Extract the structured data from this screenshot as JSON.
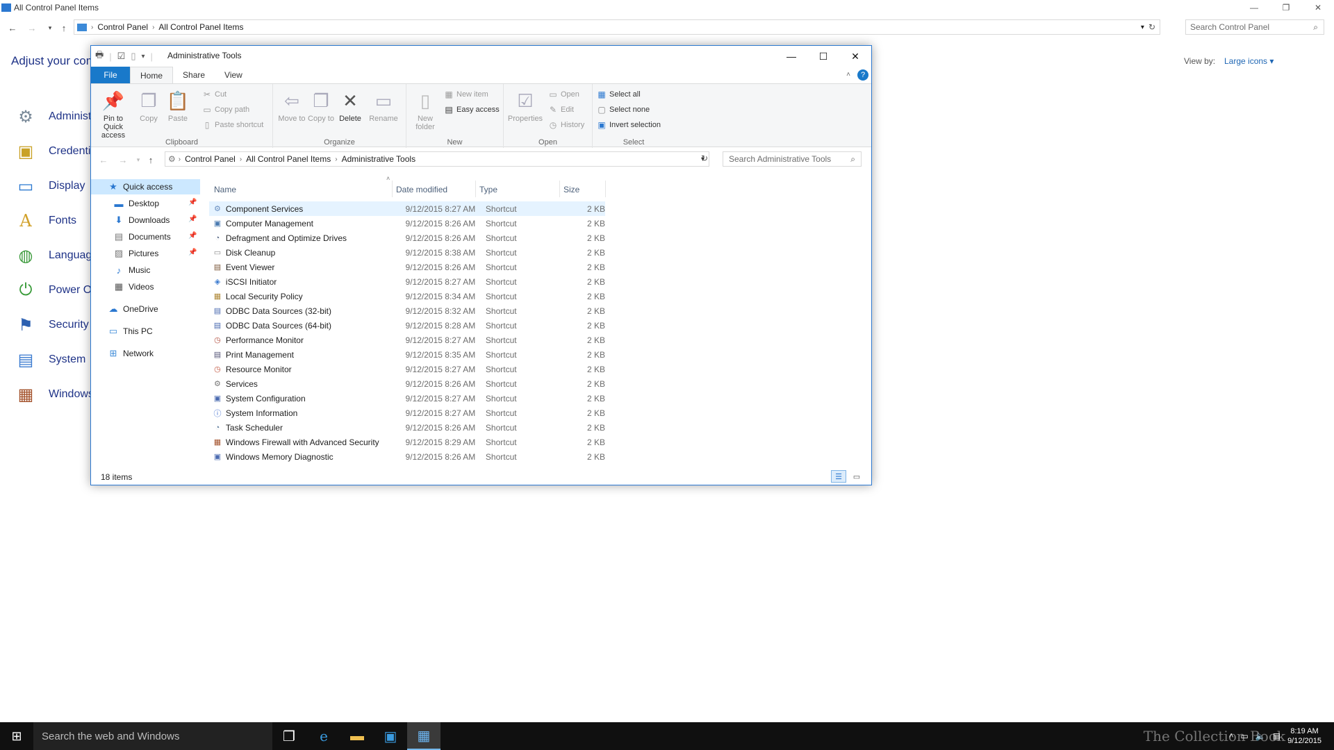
{
  "background": {
    "title": "All Control Panel Items",
    "breadcrumb": [
      "Control Panel",
      "All Control Panel Items"
    ],
    "search_placeholder": "Search Control Panel",
    "heading": "Adjust your com",
    "view_by_label": "View by:",
    "view_by_value": "Large icons ▾",
    "items": [
      {
        "label": "Administ",
        "icon": "admin-tools-icon"
      },
      {
        "label": "Credentia",
        "icon": "credential-icon"
      },
      {
        "label": "Display",
        "icon": "display-icon"
      },
      {
        "label": "Fonts",
        "icon": "fonts-icon"
      },
      {
        "label": "Language",
        "icon": "language-icon"
      },
      {
        "label": "Power Op",
        "icon": "power-icon"
      },
      {
        "label": "Security a",
        "icon": "security-flag-icon"
      },
      {
        "label": "System",
        "icon": "system-icon"
      },
      {
        "label": "Windows",
        "icon": "firewall-icon"
      }
    ]
  },
  "window": {
    "title": "Administrative Tools",
    "tabs": [
      "File",
      "Home",
      "Share",
      "View"
    ],
    "ribbon": {
      "clipboard": {
        "label": "Clipboard",
        "pin": "Pin to Quick access",
        "copy": "Copy",
        "paste": "Paste",
        "cut": "Cut",
        "copy_path": "Copy path",
        "paste_shortcut": "Paste shortcut"
      },
      "organize": {
        "label": "Organize",
        "move": "Move to",
        "copy": "Copy to",
        "delete": "Delete",
        "rename": "Rename"
      },
      "new": {
        "label": "New",
        "new_folder": "New folder",
        "new_item": "New item",
        "easy_access": "Easy access"
      },
      "open": {
        "label": "Open",
        "properties": "Properties",
        "open": "Open",
        "edit": "Edit",
        "history": "History"
      },
      "select": {
        "label": "Select",
        "all": "Select all",
        "none": "Select none",
        "invert": "Invert selection"
      }
    },
    "breadcrumb": [
      "Control Panel",
      "All Control Panel Items",
      "Administrative Tools"
    ],
    "search_placeholder": "Search Administrative Tools",
    "nav": {
      "quick_access": "Quick access",
      "desktop": "Desktop",
      "downloads": "Downloads",
      "documents": "Documents",
      "pictures": "Pictures",
      "music": "Music",
      "videos": "Videos",
      "onedrive": "OneDrive",
      "this_pc": "This PC",
      "network": "Network"
    },
    "columns": {
      "name": "Name",
      "date": "Date modified",
      "type": "Type",
      "size": "Size"
    },
    "files": [
      {
        "name": "Component Services",
        "date": "9/12/2015 8:27 AM",
        "type": "Shortcut",
        "size": "2 KB"
      },
      {
        "name": "Computer Management",
        "date": "9/12/2015 8:26 AM",
        "type": "Shortcut",
        "size": "2 KB"
      },
      {
        "name": "Defragment and Optimize Drives",
        "date": "9/12/2015 8:26 AM",
        "type": "Shortcut",
        "size": "2 KB"
      },
      {
        "name": "Disk Cleanup",
        "date": "9/12/2015 8:38 AM",
        "type": "Shortcut",
        "size": "2 KB"
      },
      {
        "name": "Event Viewer",
        "date": "9/12/2015 8:26 AM",
        "type": "Shortcut",
        "size": "2 KB"
      },
      {
        "name": "iSCSI Initiator",
        "date": "9/12/2015 8:27 AM",
        "type": "Shortcut",
        "size": "2 KB"
      },
      {
        "name": "Local Security Policy",
        "date": "9/12/2015 8:34 AM",
        "type": "Shortcut",
        "size": "2 KB"
      },
      {
        "name": "ODBC Data Sources (32-bit)",
        "date": "9/12/2015 8:32 AM",
        "type": "Shortcut",
        "size": "2 KB"
      },
      {
        "name": "ODBC Data Sources (64-bit)",
        "date": "9/12/2015 8:28 AM",
        "type": "Shortcut",
        "size": "2 KB"
      },
      {
        "name": "Performance Monitor",
        "date": "9/12/2015 8:27 AM",
        "type": "Shortcut",
        "size": "2 KB"
      },
      {
        "name": "Print Management",
        "date": "9/12/2015 8:35 AM",
        "type": "Shortcut",
        "size": "2 KB"
      },
      {
        "name": "Resource Monitor",
        "date": "9/12/2015 8:27 AM",
        "type": "Shortcut",
        "size": "2 KB"
      },
      {
        "name": "Services",
        "date": "9/12/2015 8:26 AM",
        "type": "Shortcut",
        "size": "2 KB"
      },
      {
        "name": "System Configuration",
        "date": "9/12/2015 8:27 AM",
        "type": "Shortcut",
        "size": "2 KB"
      },
      {
        "name": "System Information",
        "date": "9/12/2015 8:27 AM",
        "type": "Shortcut",
        "size": "2 KB"
      },
      {
        "name": "Task Scheduler",
        "date": "9/12/2015 8:26 AM",
        "type": "Shortcut",
        "size": "2 KB"
      },
      {
        "name": "Windows Firewall with Advanced Security",
        "date": "9/12/2015 8:29 AM",
        "type": "Shortcut",
        "size": "2 KB"
      },
      {
        "name": "Windows Memory Diagnostic",
        "date": "9/12/2015 8:26 AM",
        "type": "Shortcut",
        "size": "2 KB"
      }
    ],
    "status": "18 items"
  },
  "taskbar": {
    "search_placeholder": "Search the web and Windows",
    "time": "8:19 AM",
    "date": "9/12/2015",
    "watermark": "The Collection Book"
  },
  "colors": {
    "accent": "#1979ca",
    "link": "#1e3287",
    "selection": "#e5f3ff",
    "taskbar": "#101010"
  }
}
